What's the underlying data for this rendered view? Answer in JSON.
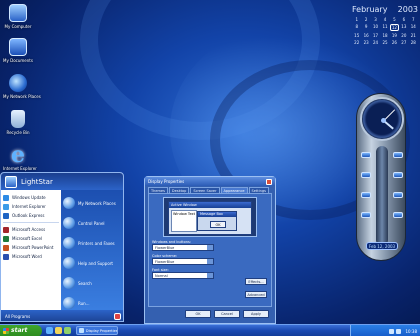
{
  "desktop": {
    "icons": [
      {
        "label": "My Computer",
        "icon": "computer-icon"
      },
      {
        "label": "My Documents",
        "icon": "documents-icon"
      },
      {
        "label": "My Network Places",
        "icon": "network-icon"
      },
      {
        "label": "Recycle Bin",
        "icon": "recycle-bin-icon"
      },
      {
        "label": "Internet Explorer",
        "icon": "internet-explorer-icon"
      }
    ]
  },
  "calendar": {
    "month": "February",
    "year": "2003",
    "days": [
      "1",
      "2",
      "3",
      "4",
      "5",
      "6",
      "7",
      "8",
      "9",
      "10",
      "11",
      "12",
      "13",
      "14",
      "15",
      "16",
      "17",
      "18",
      "19",
      "20",
      "21",
      "22",
      "23",
      "24",
      "25",
      "26",
      "27",
      "28"
    ],
    "today": "12"
  },
  "gadget": {
    "date": "Feb 12, 2003"
  },
  "start_menu": {
    "user": "LightStar",
    "pinned": [
      {
        "label": "Windows Update",
        "color": "#2d8ae5"
      },
      {
        "label": "Internet Explorer",
        "color": "#3b9be8"
      },
      {
        "label": "Outlook Express",
        "color": "#1e63c4"
      },
      {
        "label": "Microsoft Access",
        "color": "#a3262c"
      },
      {
        "label": "Microsoft Excel",
        "color": "#1e7a3c"
      },
      {
        "label": "Microsoft PowerPoint",
        "color": "#c8501e"
      },
      {
        "label": "Microsoft Word",
        "color": "#2b4fb0"
      }
    ],
    "right_items": [
      {
        "label": "My Network Places"
      },
      {
        "label": "Control Panel"
      },
      {
        "label": "Printers and Faxes"
      },
      {
        "label": "Help and Support"
      },
      {
        "label": "Search"
      },
      {
        "label": "Run..."
      }
    ],
    "all_programs": "All Programs"
  },
  "dialog": {
    "title": "Display Properties",
    "tabs": [
      "Themes",
      "Desktop",
      "Screen Saver",
      "Appearance",
      "Settings"
    ],
    "active_tab": "Appearance",
    "preview": {
      "active_window": "Active Window",
      "window_text": "Window Text",
      "message_box": "Message Box",
      "ok": "OK"
    },
    "fields": [
      {
        "label": "Windows and buttons:",
        "value": "FlowerBlue"
      },
      {
        "label": "Color scheme:",
        "value": "FlowerBlue"
      },
      {
        "label": "Font size:",
        "value": "Normal"
      }
    ],
    "effects_button": "Effects...",
    "advanced_button": "Advanced",
    "ok_button": "OK",
    "cancel_button": "Cancel",
    "apply_button": "Apply"
  },
  "taskbar": {
    "start_label": "start",
    "task_label": "Display Properties",
    "clock": "10:38"
  }
}
